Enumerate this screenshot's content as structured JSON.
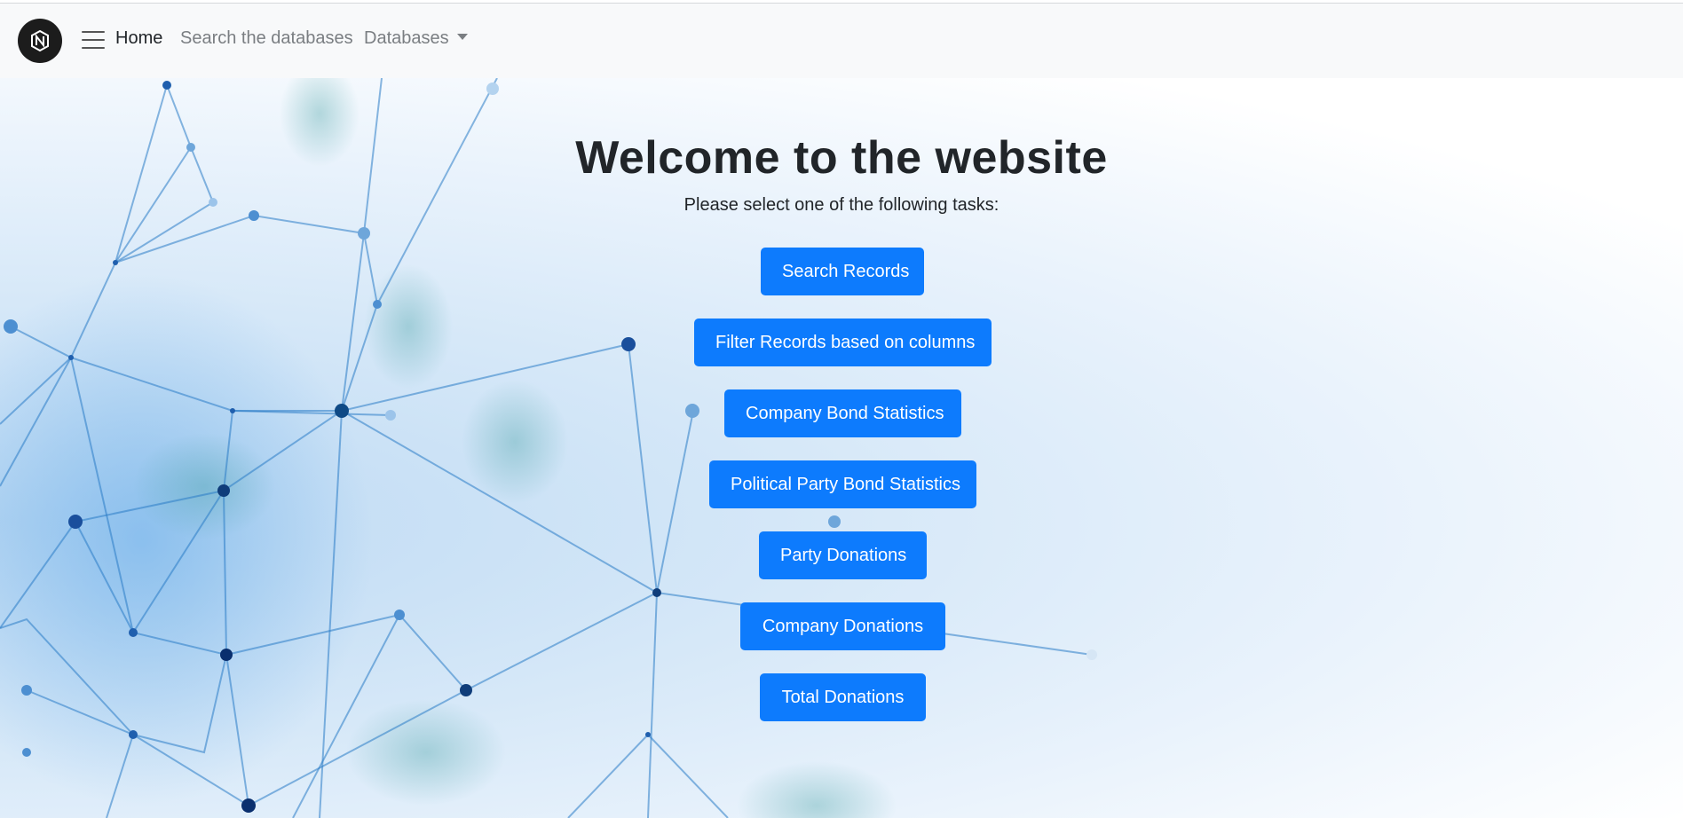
{
  "nav": {
    "logo_icon": "brand-logo-icon",
    "menu_icon": "hamburger-menu-icon",
    "home_label": "Home",
    "search_label": "Search the databases",
    "databases_label": "Databases"
  },
  "main": {
    "title": "Welcome to the website",
    "subtitle": "Please select one of the following tasks:",
    "buttons": [
      "Search Records",
      "Filter Records based on columns",
      "Company Bond Statistics",
      "Political Party Bond Statistics",
      "Party Donations",
      "Company Donations",
      "Total Donations"
    ]
  },
  "colors": {
    "primary_button": "#0d7bfd",
    "navbar_bg": "#f8f9fa",
    "logo_bg": "#1c1c1c"
  }
}
